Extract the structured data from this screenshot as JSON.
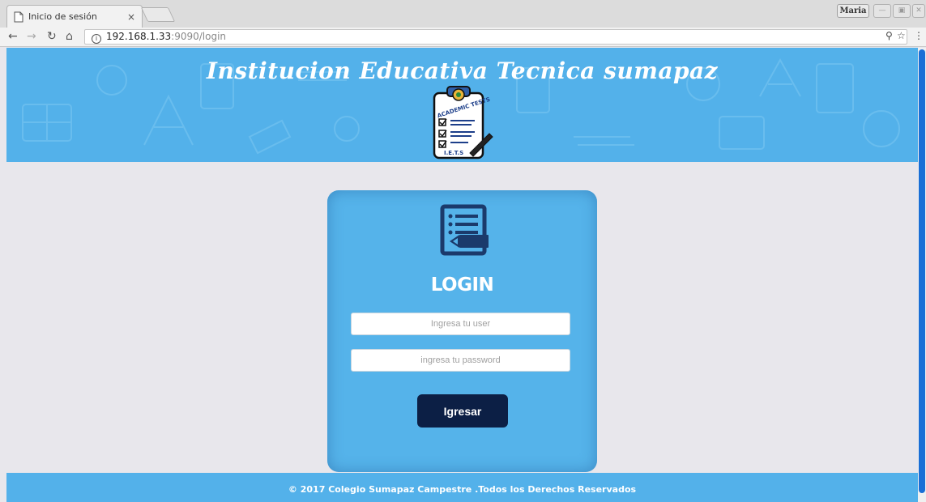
{
  "browser": {
    "tab_title": "Inicio de sesión",
    "tab_close": "×",
    "profile_name": "Maria",
    "url_host": "192.168.1.33",
    "url_rest": ":9090/login"
  },
  "header": {
    "title": "Institucion Educativa Tecnica sumapaz",
    "logo_text_top": "ACADEMIC TESTS",
    "logo_text_bottom": "I.E.T.S"
  },
  "login": {
    "title": "LOGIN",
    "user_placeholder": "Ingresa tu user",
    "password_placeholder": "ingresa tu password",
    "submit_label": "Igresar"
  },
  "footer": {
    "text": "© 2017 Colegio Sumapaz Campestre .Todos los Derechos Reservados"
  },
  "colors": {
    "brand_blue": "#53b1ea",
    "button_navy": "#0c1f45",
    "page_bg": "#e8e7ec"
  }
}
